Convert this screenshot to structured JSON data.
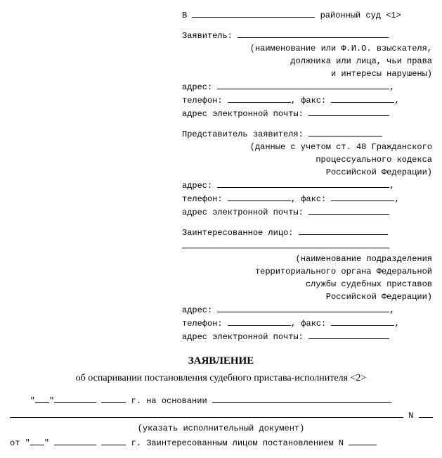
{
  "header": {
    "to_prefix": "В",
    "to_suffix": "районный суд <1>",
    "applicant": {
      "label": "Заявитель:",
      "note1": "(наименование или Ф.И.О. взыскателя,",
      "note2": "должника или лица, чьи права",
      "note3": "и интересы нарушены)"
    },
    "address_label": "адрес:",
    "phone_label": "телефон:",
    "fax_label": "факс:",
    "email_label": "адрес электронной почты:",
    "representative": {
      "label": "Представитель заявителя:",
      "note1": "(данные с учетом ст. 48 Гражданского",
      "note2": "процессуального кодекса",
      "note3": "Российской Федерации)"
    },
    "interested": {
      "label": "Заинтересованное лицо:",
      "note1": "(наименование подразделения",
      "note2": "территориального органа Федеральной",
      "note3": "службы судебных приставов",
      "note4": "Российской Федерации)"
    }
  },
  "title": {
    "main": "ЗАЯВЛЕНИЕ",
    "sub": "об оспаривании постановления судебного пристава-исполнителя <2>"
  },
  "body": {
    "line1_middle": "г. на основании",
    "line2_suffix": "N",
    "line3_note": "(указать исполнительный документ)",
    "line4_prefix": "от \"",
    "line4_quote": "\"",
    "line4_suffix": "г. Заинтересованным лицом постановлением N"
  }
}
